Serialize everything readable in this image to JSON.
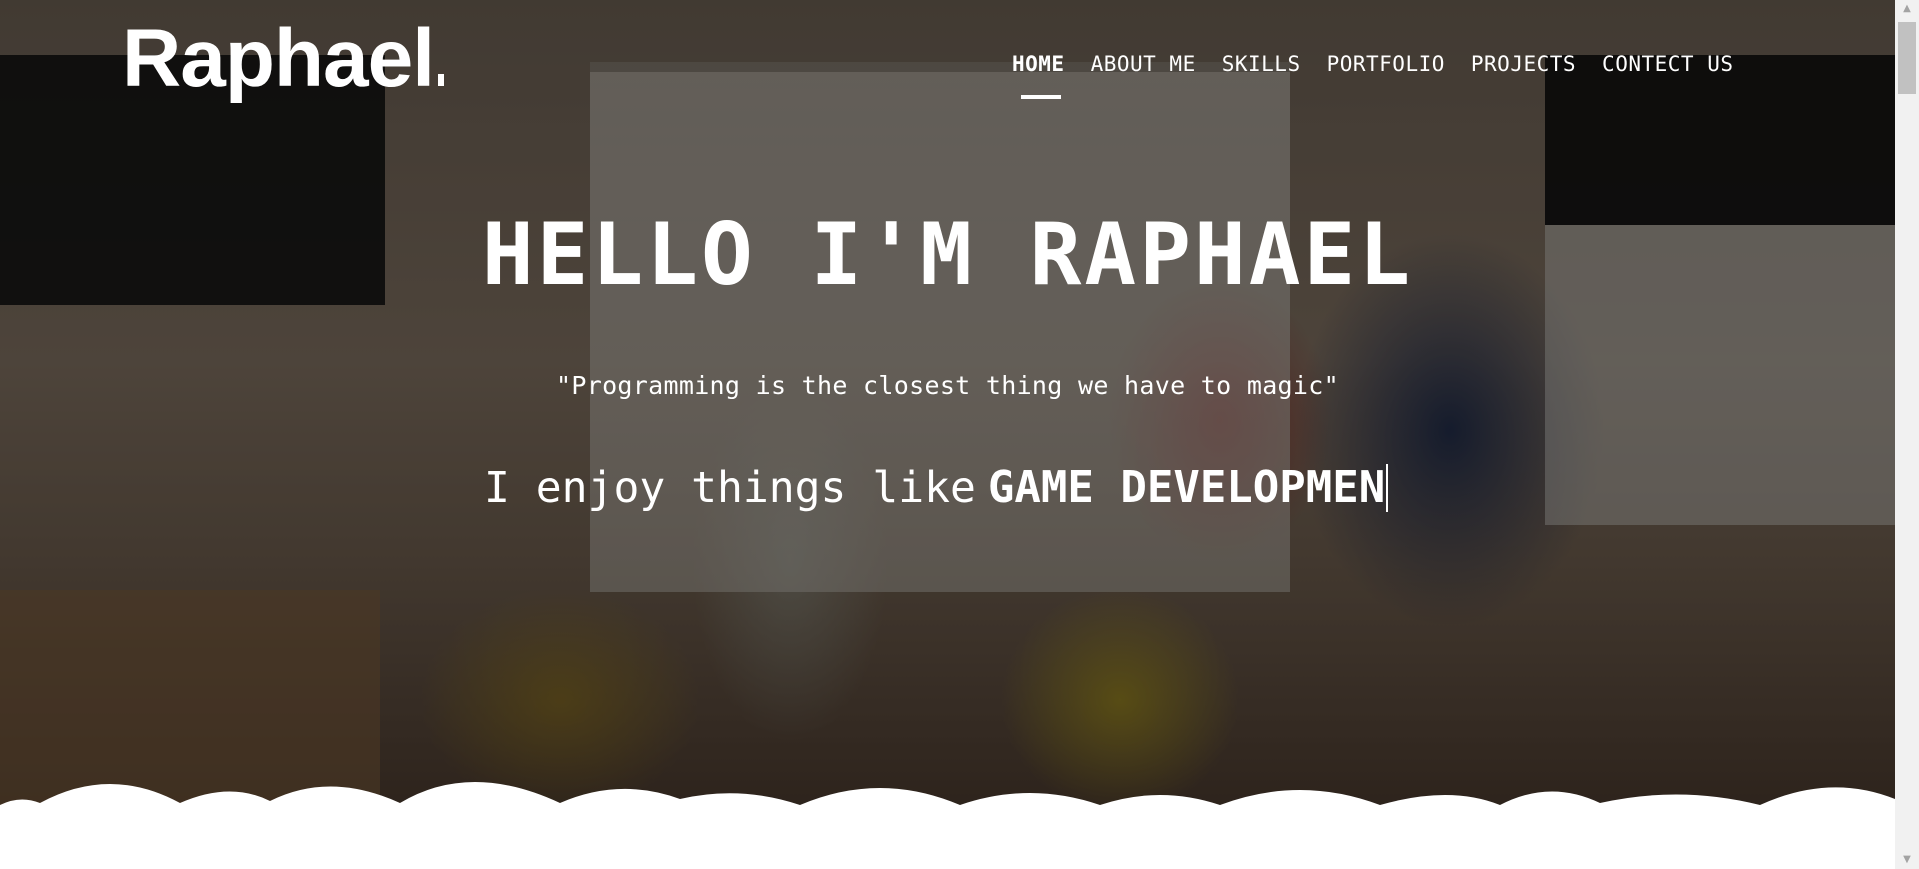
{
  "site": {
    "logo": "Raphael"
  },
  "nav": {
    "items": [
      {
        "label": "HOME",
        "active": true
      },
      {
        "label": "ABOUT ME",
        "active": false
      },
      {
        "label": "SKILLS",
        "active": false
      },
      {
        "label": "PORTFOLIO",
        "active": false
      },
      {
        "label": "PROJECTS",
        "active": false
      },
      {
        "label": "CONTECT US",
        "active": false
      }
    ]
  },
  "hero": {
    "title": "HELLO I'M RAPHAEL",
    "quote": "\"Programming is the closest thing we have to magic\"",
    "typing_prefix": "I enjoy things like",
    "typing_text": "GAME DEVELOPMEN"
  },
  "colors": {
    "text": "#ffffff",
    "overlay": "rgba(0,0,0,0.38)",
    "page_background": "#ffffff"
  }
}
